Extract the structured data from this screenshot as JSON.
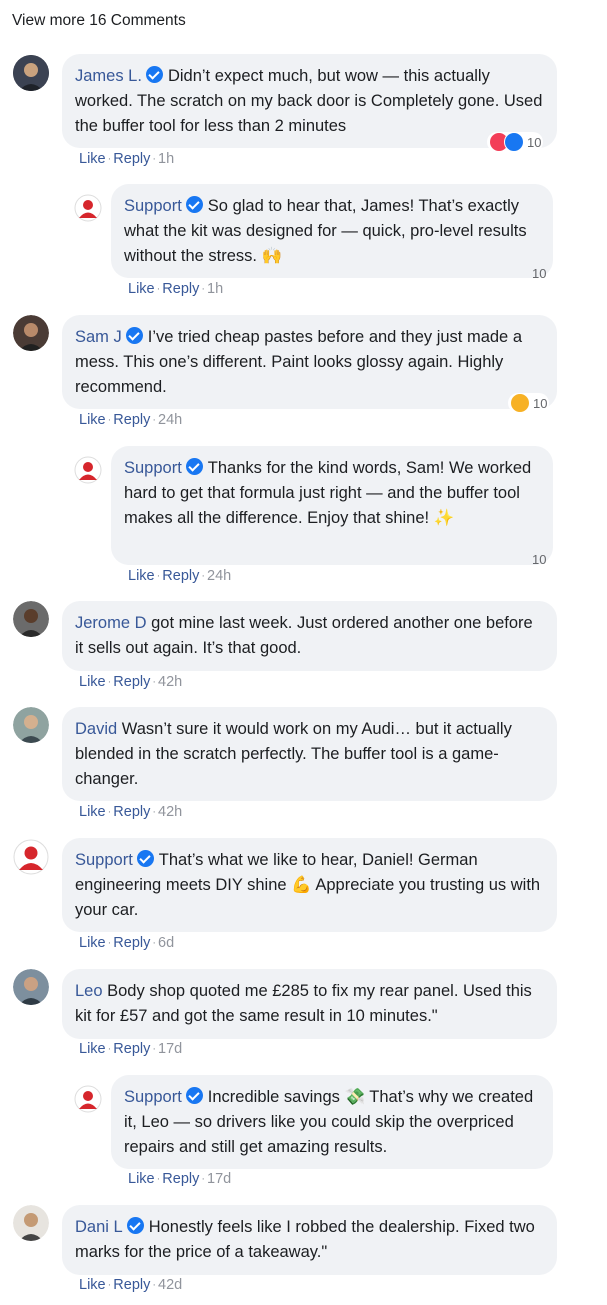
{
  "view_more": "View more 16 Comments",
  "actions": {
    "like": "Like",
    "reply": "Reply"
  },
  "colors": {
    "link": "#385898",
    "bubble": "#f0f2f5",
    "verified": "#1877f2",
    "heart": "#f33e58",
    "wow": "#f7b125"
  },
  "comments": [
    {
      "author": "James L.",
      "verified": true,
      "text": "Didn’t expect much, but wow — this actually worked. The scratch on my back door is Completely gone. Used the buffer tool for less than 2 minutes",
      "time": "1h",
      "reactions": [
        "heart-icon",
        "like-icon"
      ],
      "reaction_count": "10"
    },
    {
      "author": "Support",
      "verified": true,
      "text": "So glad to hear that, James! That’s exactly what the kit was designed for — quick, pro-level results without the stress. 🙌",
      "time": "1h",
      "reaction_count": "10"
    },
    {
      "author": "Sam J",
      "verified": true,
      "text": "I’ve tried cheap pastes before and they just made a mess. This one’s different. Paint looks glossy again. Highly recommend.",
      "time": "24h",
      "reactions": [
        "wow-icon"
      ],
      "reaction_count": "10"
    },
    {
      "author": "Support",
      "verified": true,
      "text": "Thanks for the kind words, Sam! We worked hard to get that formula just right — and the buffer tool makes all the difference. Enjoy that shine! ✨",
      "time": "24h",
      "reaction_count": "10"
    },
    {
      "author": "Jerome D",
      "verified": false,
      "text": "got mine last week. Just ordered another one before it sells out again. It’s that good.",
      "time": "42h"
    },
    {
      "author": "David",
      "verified": false,
      "text": "Wasn’t sure it would work on my Audi… but it actually blended in the scratch perfectly. The buffer tool is a game-changer.",
      "time": "42h"
    },
    {
      "author": "Support",
      "verified": true,
      "text": "That’s what we like to hear, Daniel! German engineering meets DIY shine 💪 Appreciate you trusting us with your car.",
      "time": "6d"
    },
    {
      "author": "Leo",
      "verified": false,
      "text": "Body shop quoted me £285 to fix my rear panel. Used this kit for £57 and got the same result in 10 minutes.\"",
      "time": "17d"
    },
    {
      "author": "Support",
      "verified": true,
      "text": "Incredible savings 💸 That’s why we created it, Leo — so drivers like you could skip the overpriced repairs and still get amazing results.",
      "time": "17d"
    },
    {
      "author": "Dani L",
      "verified": true,
      "text": "Honestly feels like I robbed the dealership. Fixed two marks for the price of a takeaway.\"",
      "time": "42d"
    }
  ]
}
